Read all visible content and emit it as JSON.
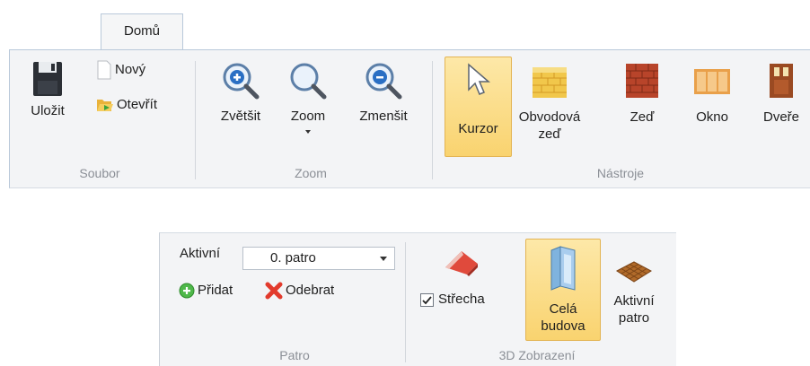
{
  "ribbon_top": {
    "tab": "Domů",
    "groups": {
      "soubor": {
        "label": "Soubor",
        "save": "Uložit",
        "new": "Nový",
        "open": "Otevřít"
      },
      "zoom": {
        "label": "Zoom",
        "zoom_in": "Zvětšit",
        "zoom": "Zoom",
        "zoom_out": "Zmenšit"
      },
      "nastroje": {
        "label": "Nástroje",
        "cursor": "Kurzor",
        "perimeter_wall_line1": "Obvodová",
        "perimeter_wall_line2": "zeď",
        "wall": "Zeď",
        "window": "Okno",
        "door": "Dveře"
      }
    }
  },
  "ribbon_bottom": {
    "patro": {
      "label": "Patro",
      "active_label": "Aktivní",
      "active_value": "0. patro",
      "add": "Přidat",
      "remove": "Odebrat"
    },
    "zobrazeni": {
      "label": "3D Zobrazení",
      "roof": "Střecha",
      "roof_checked": true,
      "whole_building_line1": "Celá",
      "whole_building_line2": "budova",
      "active_floor_line1": "Aktivní",
      "active_floor_line2": "patro"
    }
  },
  "icons": [
    "floppy-disk-icon",
    "new-file-icon",
    "open-folder-icon",
    "zoom-in-icon",
    "magnifier-icon",
    "zoom-out-icon",
    "cursor-arrow-icon",
    "perimeter-wall-icon",
    "brick-wall-icon",
    "window-icon",
    "door-icon",
    "add-green-icon",
    "remove-red-x-icon",
    "roof-icon",
    "building-icon",
    "floor-tile-icon"
  ],
  "colors": {
    "selected_fill": "#f9d36f",
    "accent_blue": "#2a6fc4"
  }
}
